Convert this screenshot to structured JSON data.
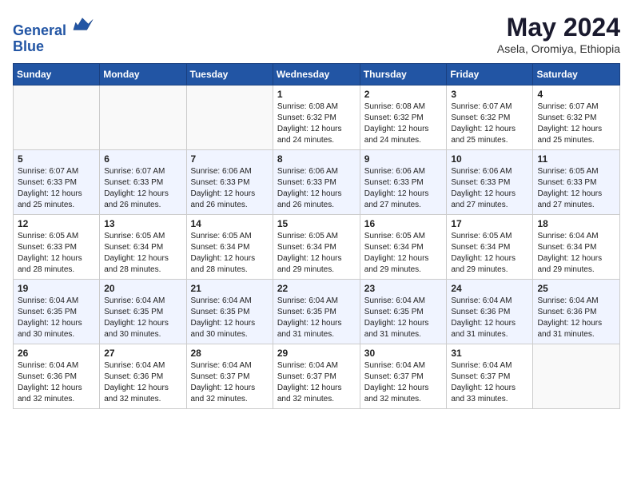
{
  "header": {
    "logo_line1": "General",
    "logo_line2": "Blue",
    "month": "May 2024",
    "location": "Asela, Oromiya, Ethiopia"
  },
  "weekdays": [
    "Sunday",
    "Monday",
    "Tuesday",
    "Wednesday",
    "Thursday",
    "Friday",
    "Saturday"
  ],
  "weeks": [
    [
      {
        "day": "",
        "info": ""
      },
      {
        "day": "",
        "info": ""
      },
      {
        "day": "",
        "info": ""
      },
      {
        "day": "1",
        "info": "Sunrise: 6:08 AM\nSunset: 6:32 PM\nDaylight: 12 hours\nand 24 minutes."
      },
      {
        "day": "2",
        "info": "Sunrise: 6:08 AM\nSunset: 6:32 PM\nDaylight: 12 hours\nand 24 minutes."
      },
      {
        "day": "3",
        "info": "Sunrise: 6:07 AM\nSunset: 6:32 PM\nDaylight: 12 hours\nand 25 minutes."
      },
      {
        "day": "4",
        "info": "Sunrise: 6:07 AM\nSunset: 6:32 PM\nDaylight: 12 hours\nand 25 minutes."
      }
    ],
    [
      {
        "day": "5",
        "info": "Sunrise: 6:07 AM\nSunset: 6:33 PM\nDaylight: 12 hours\nand 25 minutes."
      },
      {
        "day": "6",
        "info": "Sunrise: 6:07 AM\nSunset: 6:33 PM\nDaylight: 12 hours\nand 26 minutes."
      },
      {
        "day": "7",
        "info": "Sunrise: 6:06 AM\nSunset: 6:33 PM\nDaylight: 12 hours\nand 26 minutes."
      },
      {
        "day": "8",
        "info": "Sunrise: 6:06 AM\nSunset: 6:33 PM\nDaylight: 12 hours\nand 26 minutes."
      },
      {
        "day": "9",
        "info": "Sunrise: 6:06 AM\nSunset: 6:33 PM\nDaylight: 12 hours\nand 27 minutes."
      },
      {
        "day": "10",
        "info": "Sunrise: 6:06 AM\nSunset: 6:33 PM\nDaylight: 12 hours\nand 27 minutes."
      },
      {
        "day": "11",
        "info": "Sunrise: 6:05 AM\nSunset: 6:33 PM\nDaylight: 12 hours\nand 27 minutes."
      }
    ],
    [
      {
        "day": "12",
        "info": "Sunrise: 6:05 AM\nSunset: 6:33 PM\nDaylight: 12 hours\nand 28 minutes."
      },
      {
        "day": "13",
        "info": "Sunrise: 6:05 AM\nSunset: 6:34 PM\nDaylight: 12 hours\nand 28 minutes."
      },
      {
        "day": "14",
        "info": "Sunrise: 6:05 AM\nSunset: 6:34 PM\nDaylight: 12 hours\nand 28 minutes."
      },
      {
        "day": "15",
        "info": "Sunrise: 6:05 AM\nSunset: 6:34 PM\nDaylight: 12 hours\nand 29 minutes."
      },
      {
        "day": "16",
        "info": "Sunrise: 6:05 AM\nSunset: 6:34 PM\nDaylight: 12 hours\nand 29 minutes."
      },
      {
        "day": "17",
        "info": "Sunrise: 6:05 AM\nSunset: 6:34 PM\nDaylight: 12 hours\nand 29 minutes."
      },
      {
        "day": "18",
        "info": "Sunrise: 6:04 AM\nSunset: 6:34 PM\nDaylight: 12 hours\nand 29 minutes."
      }
    ],
    [
      {
        "day": "19",
        "info": "Sunrise: 6:04 AM\nSunset: 6:35 PM\nDaylight: 12 hours\nand 30 minutes."
      },
      {
        "day": "20",
        "info": "Sunrise: 6:04 AM\nSunset: 6:35 PM\nDaylight: 12 hours\nand 30 minutes."
      },
      {
        "day": "21",
        "info": "Sunrise: 6:04 AM\nSunset: 6:35 PM\nDaylight: 12 hours\nand 30 minutes."
      },
      {
        "day": "22",
        "info": "Sunrise: 6:04 AM\nSunset: 6:35 PM\nDaylight: 12 hours\nand 31 minutes."
      },
      {
        "day": "23",
        "info": "Sunrise: 6:04 AM\nSunset: 6:35 PM\nDaylight: 12 hours\nand 31 minutes."
      },
      {
        "day": "24",
        "info": "Sunrise: 6:04 AM\nSunset: 6:36 PM\nDaylight: 12 hours\nand 31 minutes."
      },
      {
        "day": "25",
        "info": "Sunrise: 6:04 AM\nSunset: 6:36 PM\nDaylight: 12 hours\nand 31 minutes."
      }
    ],
    [
      {
        "day": "26",
        "info": "Sunrise: 6:04 AM\nSunset: 6:36 PM\nDaylight: 12 hours\nand 32 minutes."
      },
      {
        "day": "27",
        "info": "Sunrise: 6:04 AM\nSunset: 6:36 PM\nDaylight: 12 hours\nand 32 minutes."
      },
      {
        "day": "28",
        "info": "Sunrise: 6:04 AM\nSunset: 6:37 PM\nDaylight: 12 hours\nand 32 minutes."
      },
      {
        "day": "29",
        "info": "Sunrise: 6:04 AM\nSunset: 6:37 PM\nDaylight: 12 hours\nand 32 minutes."
      },
      {
        "day": "30",
        "info": "Sunrise: 6:04 AM\nSunset: 6:37 PM\nDaylight: 12 hours\nand 32 minutes."
      },
      {
        "day": "31",
        "info": "Sunrise: 6:04 AM\nSunset: 6:37 PM\nDaylight: 12 hours\nand 33 minutes."
      },
      {
        "day": "",
        "info": ""
      }
    ]
  ]
}
